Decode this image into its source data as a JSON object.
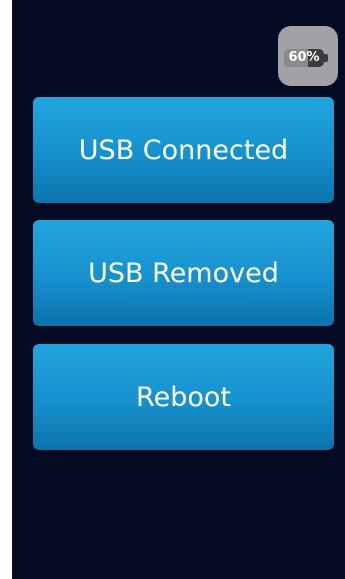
{
  "status": {
    "battery_label": "60%",
    "battery_level": 0.6
  },
  "buttons": {
    "usb_connected": "USB Connected",
    "usb_removed": "USB Removed",
    "reboot": "Reboot"
  },
  "colors": {
    "background": "#050b22",
    "button": "#1a96d4",
    "battery_box": "#a2a2a6"
  }
}
